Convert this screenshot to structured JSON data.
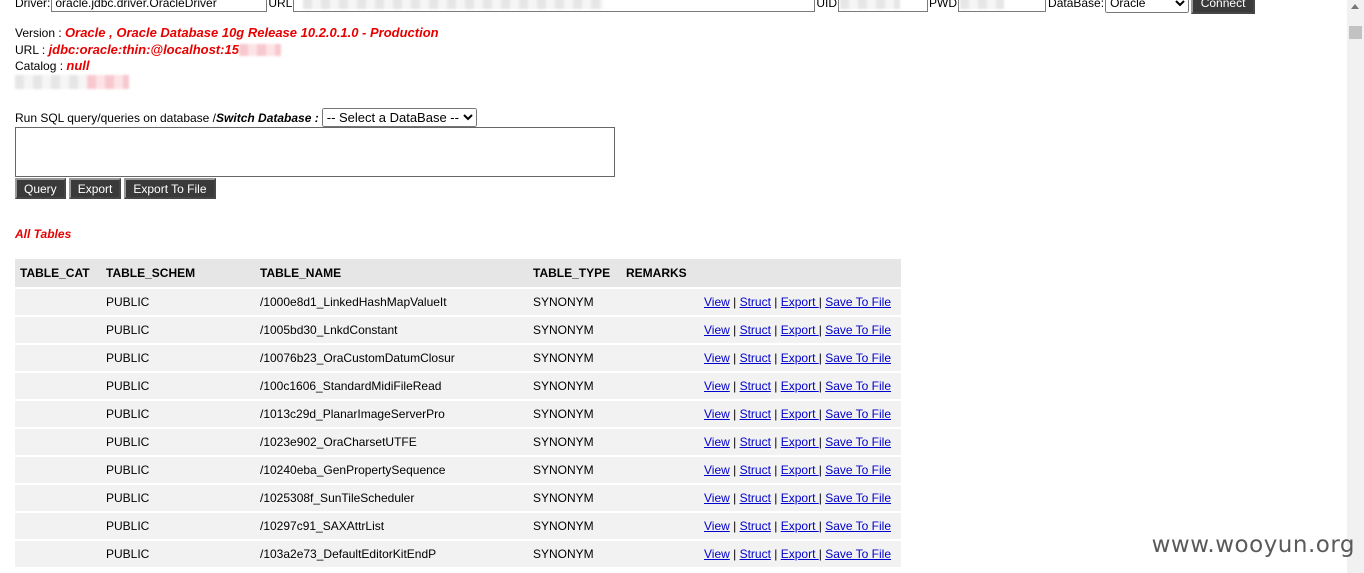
{
  "connect_bar": {
    "driver_label": "Driver:",
    "driver_value": "oracle.jdbc.driver.OracleDriver",
    "url_label": "URL",
    "url_value": "",
    "uid_label": "UID",
    "pwd_label": "PWD",
    "database_label": "DataBase:",
    "database_selected": "Oracle",
    "connect_label": "Connect"
  },
  "info": {
    "version_label": "Version : ",
    "version_value": "Oracle , Oracle Database 10g Release 10.2.0.1.0 - Production",
    "url_label": "URL : ",
    "url_value": "jdbc:oracle:thin:@localhost:15",
    "catalog_label": "Catalog : ",
    "catalog_value": "null"
  },
  "sql": {
    "run_label": "Run SQL query/queries on database / ",
    "switch_label": "Switch Database :",
    "switch_selected": "-- Select a DataBase --",
    "query_value": "",
    "query_button": "Query",
    "export_button": "Export",
    "export_file_button": "Export To File"
  },
  "all_tables_label": "All Tables",
  "table": {
    "headers": [
      "TABLE_CAT",
      "TABLE_SCHEM",
      "TABLE_NAME",
      "TABLE_TYPE",
      "REMARKS"
    ],
    "actions": {
      "view": "View",
      "struct": "Struct",
      "export": "Export ",
      "save": "Save To File",
      "sep": " | "
    },
    "rows": [
      {
        "cat": "",
        "schem": "PUBLIC",
        "name": "/1000e8d1_LinkedHashMapValueIt",
        "type": "SYNONYM",
        "remarks": ""
      },
      {
        "cat": "",
        "schem": "PUBLIC",
        "name": "/1005bd30_LnkdConstant",
        "type": "SYNONYM",
        "remarks": ""
      },
      {
        "cat": "",
        "schem": "PUBLIC",
        "name": "/10076b23_OraCustomDatumClosur",
        "type": "SYNONYM",
        "remarks": ""
      },
      {
        "cat": "",
        "schem": "PUBLIC",
        "name": "/100c1606_StandardMidiFileRead",
        "type": "SYNONYM",
        "remarks": ""
      },
      {
        "cat": "",
        "schem": "PUBLIC",
        "name": "/1013c29d_PlanarImageServerPro",
        "type": "SYNONYM",
        "remarks": ""
      },
      {
        "cat": "",
        "schem": "PUBLIC",
        "name": "/1023e902_OraCharsetUTFE",
        "type": "SYNONYM",
        "remarks": ""
      },
      {
        "cat": "",
        "schem": "PUBLIC",
        "name": "/10240eba_GenPropertySequence",
        "type": "SYNONYM",
        "remarks": ""
      },
      {
        "cat": "",
        "schem": "PUBLIC",
        "name": "/1025308f_SunTileScheduler",
        "type": "SYNONYM",
        "remarks": ""
      },
      {
        "cat": "",
        "schem": "PUBLIC",
        "name": "/10297c91_SAXAttrList",
        "type": "SYNONYM",
        "remarks": ""
      },
      {
        "cat": "",
        "schem": "PUBLIC",
        "name": "/103a2e73_DefaultEditorKitEndP",
        "type": "SYNONYM",
        "remarks": ""
      }
    ]
  },
  "watermark": "www.wooyun.org"
}
